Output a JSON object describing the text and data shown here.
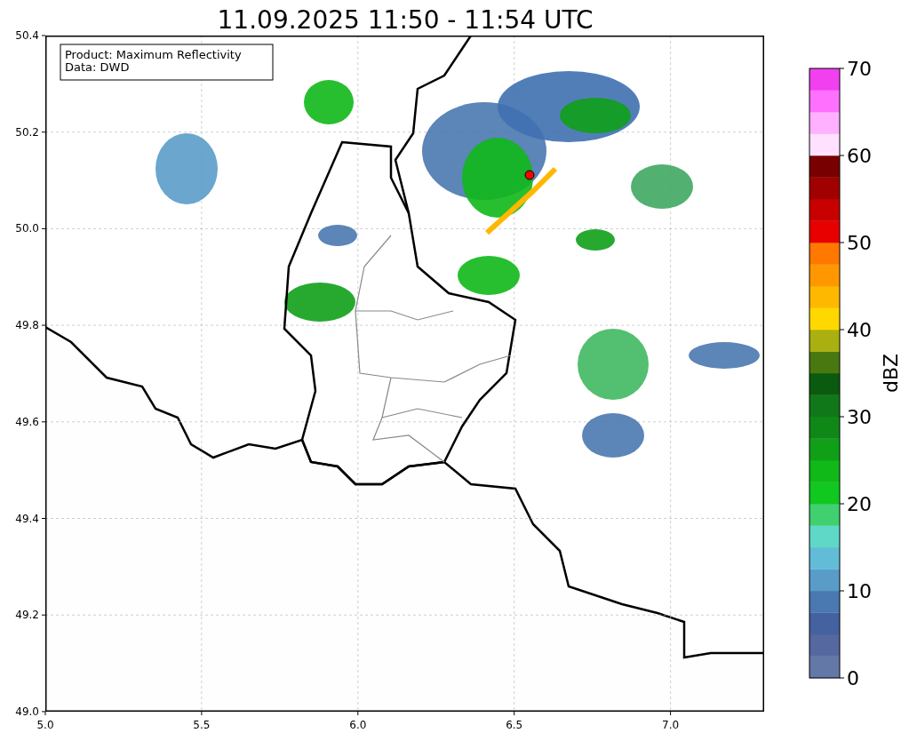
{
  "title": "11.09.2025 11:50 - 11:54 UTC",
  "map": {
    "xticks": [
      "5.0",
      "5.5",
      "6.0",
      "6.5",
      "7.0"
    ],
    "yticks": [
      "50.4",
      "50.2",
      "50.0",
      "49.8",
      "49.6",
      "49.4",
      "49.2",
      "49.0"
    ],
    "legend": [
      "Product: Maximum Reflectivity",
      "Data: DWD"
    ]
  },
  "colorbar": {
    "label": "dBZ",
    "ticks": [
      "70",
      "60",
      "50",
      "40",
      "30",
      "20",
      "10",
      "0"
    ],
    "bands": [
      {
        "color": "#6478a8"
      },
      {
        "color": "#5568a0"
      },
      {
        "color": "#4462a0"
      },
      {
        "color": "#4a78b0"
      },
      {
        "color": "#5a9cc8"
      },
      {
        "color": "#62bcd8"
      },
      {
        "color": "#60d8c8"
      },
      {
        "color": "#40d070"
      },
      {
        "color": "#10c820"
      },
      {
        "color": "#10b818"
      },
      {
        "color": "#10a018"
      },
      {
        "color": "#108818"
      },
      {
        "color": "#107818"
      },
      {
        "color": "#0a5a10"
      },
      {
        "color": "#4a7810"
      },
      {
        "color": "#aab010"
      },
      {
        "color": "#ffd800"
      },
      {
        "color": "#ffb800"
      },
      {
        "color": "#ff9800"
      },
      {
        "color": "#ff7800"
      },
      {
        "color": "#e80000"
      },
      {
        "color": "#c80000"
      },
      {
        "color": "#a00000"
      },
      {
        "color": "#780000"
      },
      {
        "color": "#ffe0ff"
      },
      {
        "color": "#ffb0ff"
      },
      {
        "color": "#ff70ff"
      },
      {
        "color": "#f040f0"
      }
    ]
  }
}
